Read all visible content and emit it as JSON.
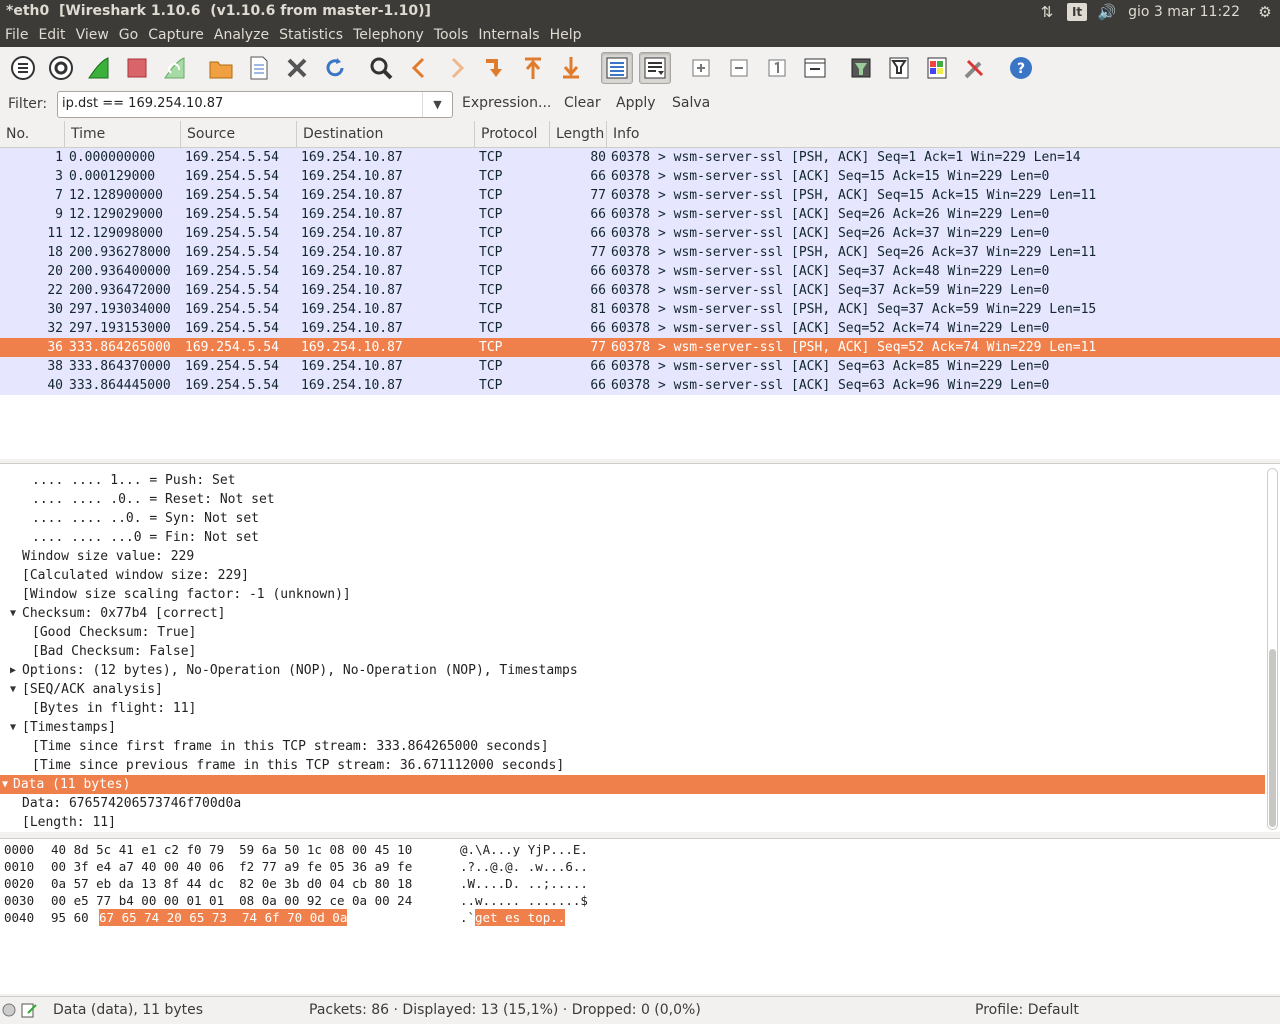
{
  "window": {
    "title": "*eth0  [Wireshark 1.10.6  (v1.10.6 from master-1.10)]"
  },
  "tray": {
    "lang": "It",
    "clock": "gio 3 mar 11:22"
  },
  "menu": [
    "File",
    "Edit",
    "View",
    "Go",
    "Capture",
    "Analyze",
    "Statistics",
    "Telephony",
    "Tools",
    "Internals",
    "Help"
  ],
  "filter": {
    "label": "Filter:",
    "value": "ip.dst == 169.254.10.87",
    "expression": "Expression...",
    "clear": "Clear",
    "apply": "Apply",
    "save": "Salva"
  },
  "packet_list": {
    "columns": [
      "No.",
      "Time",
      "Source",
      "Destination",
      "Protocol",
      "Length",
      "Info"
    ],
    "rows": [
      {
        "no": "1",
        "time": "0.000000000",
        "src": "169.254.5.54",
        "dst": "169.254.10.87",
        "proto": "TCP",
        "len": "80",
        "info": "60378 > wsm-server-ssl [PSH, ACK] Seq=1 Ack=1 Win=229 Len=14"
      },
      {
        "no": "3",
        "time": "0.000129000",
        "src": "169.254.5.54",
        "dst": "169.254.10.87",
        "proto": "TCP",
        "len": "66",
        "info": "60378 > wsm-server-ssl [ACK] Seq=15 Ack=15 Win=229 Len=0"
      },
      {
        "no": "7",
        "time": "12.128900000",
        "src": "169.254.5.54",
        "dst": "169.254.10.87",
        "proto": "TCP",
        "len": "77",
        "info": "60378 > wsm-server-ssl [PSH, ACK] Seq=15 Ack=15 Win=229 Len=11"
      },
      {
        "no": "9",
        "time": "12.129029000",
        "src": "169.254.5.54",
        "dst": "169.254.10.87",
        "proto": "TCP",
        "len": "66",
        "info": "60378 > wsm-server-ssl [ACK] Seq=26 Ack=26 Win=229 Len=0"
      },
      {
        "no": "11",
        "time": "12.129098000",
        "src": "169.254.5.54",
        "dst": "169.254.10.87",
        "proto": "TCP",
        "len": "66",
        "info": "60378 > wsm-server-ssl [ACK] Seq=26 Ack=37 Win=229 Len=0"
      },
      {
        "no": "18",
        "time": "200.936278000",
        "src": "169.254.5.54",
        "dst": "169.254.10.87",
        "proto": "TCP",
        "len": "77",
        "info": "60378 > wsm-server-ssl [PSH, ACK] Seq=26 Ack=37 Win=229 Len=11"
      },
      {
        "no": "20",
        "time": "200.936400000",
        "src": "169.254.5.54",
        "dst": "169.254.10.87",
        "proto": "TCP",
        "len": "66",
        "info": "60378 > wsm-server-ssl [ACK] Seq=37 Ack=48 Win=229 Len=0"
      },
      {
        "no": "22",
        "time": "200.936472000",
        "src": "169.254.5.54",
        "dst": "169.254.10.87",
        "proto": "TCP",
        "len": "66",
        "info": "60378 > wsm-server-ssl [ACK] Seq=37 Ack=59 Win=229 Len=0"
      },
      {
        "no": "30",
        "time": "297.193034000",
        "src": "169.254.5.54",
        "dst": "169.254.10.87",
        "proto": "TCP",
        "len": "81",
        "info": "60378 > wsm-server-ssl [PSH, ACK] Seq=37 Ack=59 Win=229 Len=15"
      },
      {
        "no": "32",
        "time": "297.193153000",
        "src": "169.254.5.54",
        "dst": "169.254.10.87",
        "proto": "TCP",
        "len": "66",
        "info": "60378 > wsm-server-ssl [ACK] Seq=52 Ack=74 Win=229 Len=0"
      },
      {
        "no": "36",
        "time": "333.864265000",
        "src": "169.254.5.54",
        "dst": "169.254.10.87",
        "proto": "TCP",
        "len": "77",
        "info": "60378 > wsm-server-ssl [PSH, ACK] Seq=52 Ack=74 Win=229 Len=11",
        "selected": true
      },
      {
        "no": "38",
        "time": "333.864370000",
        "src": "169.254.5.54",
        "dst": "169.254.10.87",
        "proto": "TCP",
        "len": "66",
        "info": "60378 > wsm-server-ssl [ACK] Seq=63 Ack=85 Win=229 Len=0"
      },
      {
        "no": "40",
        "time": "333.864445000",
        "src": "169.254.5.54",
        "dst": "169.254.10.87",
        "proto": "TCP",
        "len": "66",
        "info": "60378 > wsm-server-ssl [ACK] Seq=63 Ack=96 Win=229 Len=0"
      }
    ]
  },
  "details": [
    {
      "text": ".... .... 1... = Push: Set",
      "indent": 2
    },
    {
      "text": ".... .... .0.. = Reset: Not set",
      "indent": 2
    },
    {
      "text": ".... .... ..0. = Syn: Not set",
      "indent": 2
    },
    {
      "text": ".... .... ...0 = Fin: Not set",
      "indent": 2
    },
    {
      "text": "Window size value: 229",
      "indent": 1
    },
    {
      "text": "[Calculated window size: 229]",
      "indent": 1
    },
    {
      "text": "[Window size scaling factor: -1 (unknown)]",
      "indent": 1
    },
    {
      "text": "Checksum: 0x77b4 [correct]",
      "indent": 1,
      "toggle": "expanded"
    },
    {
      "text": "[Good Checksum: True]",
      "indent": 2
    },
    {
      "text": "[Bad Checksum: False]",
      "indent": 2
    },
    {
      "text": "Options: (12 bytes), No-Operation (NOP), No-Operation (NOP), Timestamps",
      "indent": 1,
      "toggle": "collapsed"
    },
    {
      "text": "[SEQ/ACK analysis]",
      "indent": 1,
      "toggle": "expanded"
    },
    {
      "text": "[Bytes in flight: 11]",
      "indent": 2
    },
    {
      "text": "[Timestamps]",
      "indent": 1,
      "toggle": "expanded"
    },
    {
      "text": "[Time since first frame in this TCP stream: 333.864265000 seconds]",
      "indent": 2
    },
    {
      "text": "[Time since previous frame in this TCP stream: 36.671112000 seconds]",
      "indent": 2
    },
    {
      "text": "Data (11 bytes)",
      "indent": 0,
      "toggle": "expanded",
      "selected": true
    },
    {
      "text": "Data: 676574206573746f700d0a",
      "indent": 1
    },
    {
      "text": "[Length: 11]",
      "indent": 1
    }
  ],
  "bytes": [
    {
      "offset": "0000",
      "hex": "40 8d 5c 41 e1 c2 f0 79  59 6a 50 1c 08 00 45 10",
      "ascii": "@.\\A...y YjP...E."
    },
    {
      "offset": "0010",
      "hex": "00 3f e4 a7 40 00 40 06  f2 77 a9 fe 05 36 a9 fe",
      "ascii": ".?..@.@. .w...6.."
    },
    {
      "offset": "0020",
      "hex": "0a 57 eb da 13 8f 44 dc  82 0e 3b d0 04 cb 80 18",
      "ascii": ".W....D. ..;....."
    },
    {
      "offset": "0030",
      "hex": "00 e5 77 b4 00 00 01 01  08 0a 00 92 ce 0a 00 24",
      "ascii": "..w..... .......$"
    },
    {
      "offset": "0040",
      "hex_plain": "95 60 ",
      "hex_hl": "67 65 74 20 65 73  74 6f 70 0d 0a",
      "ascii_plain": ".`",
      "ascii_hl": "get es top.."
    }
  ],
  "status": {
    "field": "Data (data), 11 bytes",
    "packets": "Packets: 86 · Displayed: 13 (15,1%)  · Dropped: 0 (0,0%)",
    "profile": "Profile: Default"
  }
}
